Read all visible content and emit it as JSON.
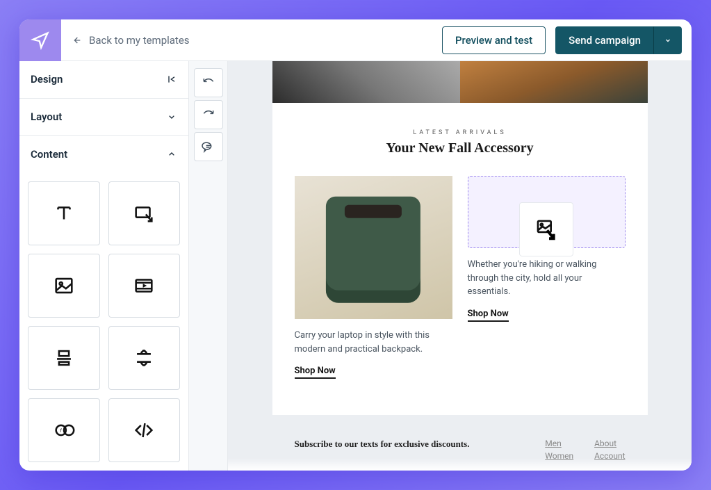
{
  "header": {
    "back_label": "Back to my templates",
    "preview_label": "Preview and test",
    "send_label": "Send campaign"
  },
  "sidebar": {
    "sections": {
      "design": "Design",
      "layout": "Layout",
      "content": "Content"
    },
    "content_blocks": [
      "text-block",
      "interactive-block",
      "image-block",
      "video-block",
      "divider-block",
      "spacer-block",
      "social-block",
      "code-block"
    ]
  },
  "tools": [
    "undo",
    "redo",
    "comment"
  ],
  "email": {
    "eyebrow": "LATEST ARRIVALS",
    "headline": "Your New Fall Accessory",
    "product1": {
      "desc": "Carry your laptop in style with this modern and practical backpack.",
      "cta": "Shop Now"
    },
    "product2": {
      "desc": "Whether you're hiking or walking through the city, hold all your essentials.",
      "cta": "Shop Now"
    },
    "footer": {
      "subscribe": "Subscribe to our texts for exclusive discounts.",
      "col1": [
        "Men",
        "Women"
      ],
      "col2": [
        "About",
        "Account"
      ]
    }
  }
}
